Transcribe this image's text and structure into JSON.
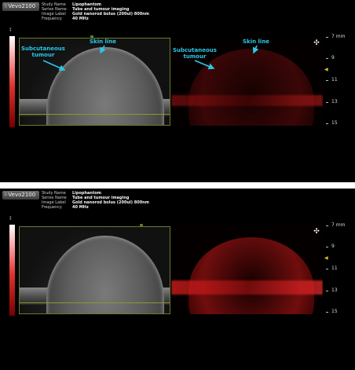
{
  "logo": {
    "text": "Vevo2100",
    "icon": "grid-dots-icon"
  },
  "metadata": [
    {
      "key": "Study Name",
      "value": "Lipophantom"
    },
    {
      "key": "Series Name",
      "value": "Tube and tumour imaging"
    },
    {
      "key": "Image Label",
      "value": "Gold nanorod bolus (200ul) 800nm"
    },
    {
      "key": "Frequency",
      "value": "40 MHz"
    }
  ],
  "annotations": {
    "left_tumour": "Subcutaneous\ntumour",
    "left_skin": "Skin line",
    "right_tumour": "Subcutaneous\ntumour",
    "right_skin": "Skin line"
  },
  "ruler": {
    "unit": "mm",
    "top_label": "7 mm",
    "labels": [
      "9",
      "11",
      "13",
      "15"
    ]
  },
  "annotation_color": "#28c8e8",
  "pa_color": "#d02020"
}
